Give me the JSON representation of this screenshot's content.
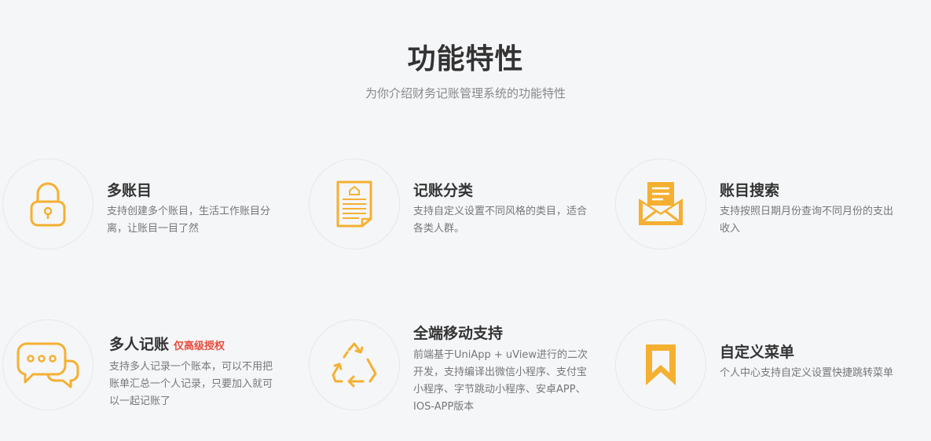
{
  "header": {
    "title": "功能特性",
    "subtitle": "为你介绍财务记账管理系统的功能特性"
  },
  "accent_color": "#f5b031",
  "features": [
    {
      "icon": "padlock-icon",
      "title": "多账目",
      "badge": "",
      "description": "支持创建多个账目，生活工作账目分离，让账目一目了然"
    },
    {
      "icon": "document-icon",
      "title": "记账分类",
      "badge": "",
      "description": "支持自定义设置不同风格的类目，适合各类人群。"
    },
    {
      "icon": "envelope-icon",
      "title": "账目搜索",
      "badge": "",
      "description": "支持按照日期月份查询不同月份的支出收入"
    },
    {
      "icon": "chat-bubbles-icon",
      "title": "多人记账",
      "badge": "仅高级授权",
      "description": "支持多人记录一个账本，可以不用把账单汇总一个人记录，只要加入就可以一起记账了"
    },
    {
      "icon": "recycle-arrows-icon",
      "title": "全端移动支持",
      "badge": "",
      "description": "前端基于UniApp + uView进行的二次开发，支持编译出微信小程序、支付宝小程序、字节跳动小程序、安卓APP、IOS-APP版本"
    },
    {
      "icon": "bookmark-icon",
      "title": "自定义菜单",
      "badge": "",
      "description": "个人中心支持自定义设置快捷跳转菜单"
    }
  ]
}
